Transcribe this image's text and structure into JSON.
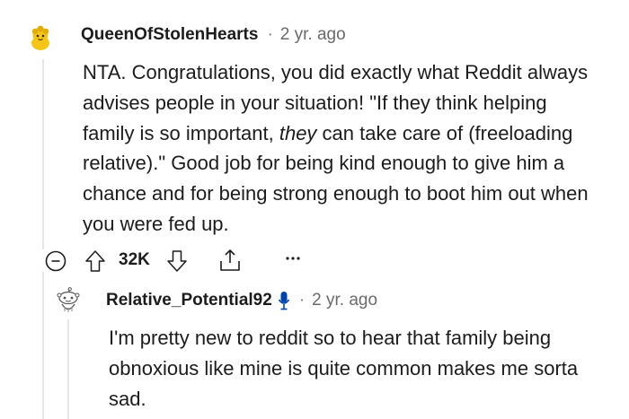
{
  "comment": {
    "username": "QueenOfStolenHearts",
    "separator": "·",
    "time": "2 yr. ago",
    "body_part1": "NTA. Congratulations, you did exactly what Reddit always advises people in your situation! \"If they think helping family is so important, ",
    "body_emphasis": "they",
    "body_part2": " can take care of (freeloading relative).\" Good job for being kind enough to give him a chance and for being strong enough to boot him out when you were fed up.",
    "score": "32K",
    "icons": [
      "collapse-icon",
      "upvote-icon",
      "downvote-icon",
      "share-icon",
      "more-icon"
    ]
  },
  "reply": {
    "username": "Relative_Potential92",
    "separator": "·",
    "time": "2 yr. ago",
    "body": "I'm pretty new to reddit so to hear that family being obnoxious like mine is quite common makes me sorta sad.",
    "icons": [
      "microphone-icon"
    ]
  },
  "colors": {
    "text": "#1c1c1c",
    "muted": "#6a6a6a",
    "thread_line": "#e4e6e8",
    "mic_blue": "#0045ac",
    "avatar_yellow": "#f5c518"
  }
}
